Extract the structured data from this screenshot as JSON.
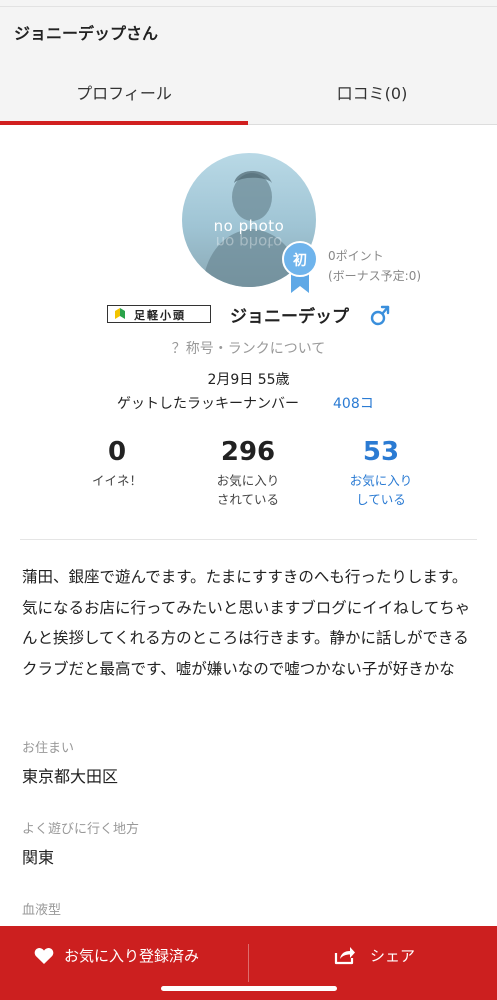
{
  "header": {
    "title": "ジョニーデップさん",
    "tabs": [
      {
        "label": "プロフィール",
        "active": true
      },
      {
        "label": "口コミ(0)",
        "active": false
      }
    ],
    "accent_color": "#d11f1f"
  },
  "profile": {
    "avatar_text": "no photo",
    "rank_badge": "初",
    "points_line1": "0ポイント",
    "points_line2": "(ボーナス予定:0)",
    "title_badge": "足軽小頭",
    "name": "ジョニーデップ",
    "gender_icon": "male-icon",
    "rank_link": "？称号・ランクについて",
    "birth_age": "2月9日 55歳",
    "lucky_label": "ゲットしたラッキーナンバー",
    "lucky_value": "408コ"
  },
  "stats": [
    {
      "value": "0",
      "label_line1": "イイネ！",
      "label_line2": ""
    },
    {
      "value": "296",
      "label_line1": "お気に入り",
      "label_line2": "されている"
    },
    {
      "value": "53",
      "label_line1": "お気に入り",
      "label_line2": "している"
    }
  ],
  "bio": "蒲田、銀座で遊んでます。たまにすすきのへも行ったりします。気になるお店に行ってみたいと思いますブログにイイねしてちゃんと挨拶してくれる方のところは行きます。静かに話しができるクラブだと最高です、嘘が嫌いなので嘘つかない子が好きかな",
  "fields": [
    {
      "label": "お住まい",
      "value": "東京都大田区"
    },
    {
      "label": "よく遊びに行く地方",
      "value": "関東"
    },
    {
      "label": "血液型",
      "value": ""
    }
  ],
  "bottom": {
    "favorite_label": "お気に入り登録済み",
    "favorite_icon": "heart-icon",
    "share_label": "シェア",
    "share_icon": "share-icon",
    "bar_color": "#cc1f1f"
  },
  "link_color": "#2b7bd3"
}
